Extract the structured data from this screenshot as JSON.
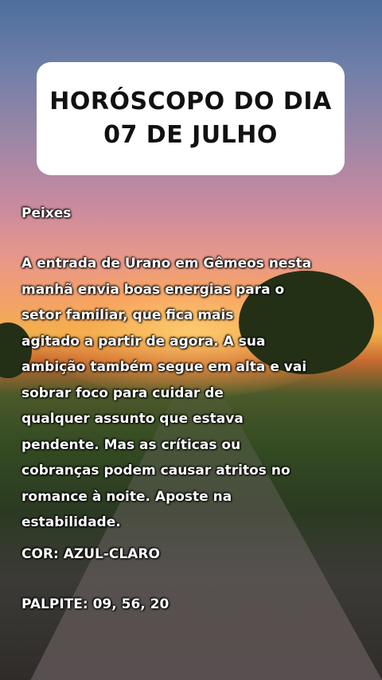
{
  "title": {
    "line1": "HORÓSCOPO DO DIA",
    "line2": "07 DE JULHO"
  },
  "sign": "Peixes",
  "body_lines": [
    "A entrada de Urano em Gêmeos nesta",
    "manhã envia boas energias para o",
    "setor familiar, que fica mais",
    "agitado a partir de agora. A sua",
    "ambição também segue em alta e vai",
    "sobrar foco para cuidar de",
    "qualquer assunto que estava",
    "pendente. Mas as críticas ou",
    "cobranças podem causar atritos no",
    "romance à noite. Aposte na",
    "estabilidade."
  ],
  "color_line": "COR: AZUL-CLARO",
  "lucky_line": "PALPITE: 09, 56, 20"
}
